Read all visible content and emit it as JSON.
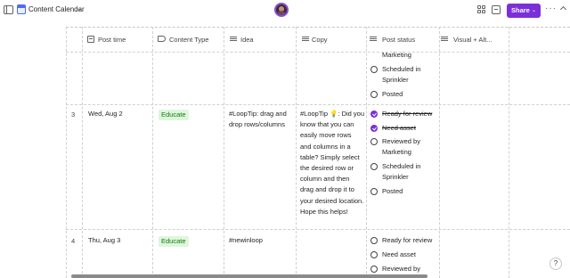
{
  "app": {
    "title": "Content Calendar",
    "share_label": "Share",
    "more_label": "···",
    "help_label": "?"
  },
  "icons": {
    "sidebar_toggle": "sidebar-icon",
    "page": "calendar-icon",
    "avatar": "user-avatar",
    "apps": "apps-icon",
    "comments": "comment-icon",
    "collapse": "collapse-icon"
  },
  "colors": {
    "accent": "#7b2fd9",
    "badge_bg": "#dff6dd",
    "badge_fg": "#107c10"
  },
  "table": {
    "columns": [
      {
        "label": "Post time",
        "icon": "grid-icon"
      },
      {
        "label": "Content Type",
        "icon": "tag-icon"
      },
      {
        "label": "Idea",
        "icon": "text-icon"
      },
      {
        "label": "Copy",
        "icon": "text-icon"
      },
      {
        "label": "Post status",
        "icon": "text-icon"
      },
      {
        "label": "Visual + Alt...",
        "icon": "text-icon"
      }
    ],
    "partial_row": {
      "status_options": [
        {
          "label": "Marketing",
          "checked": false,
          "show_circle": false
        },
        {
          "label": "Scheduled in Sprinkler",
          "checked": false,
          "show_circle": true
        },
        {
          "label": "Posted",
          "checked": false,
          "show_circle": true
        }
      ]
    },
    "rows": [
      {
        "number": "3",
        "post_time": "Wed, Aug 2",
        "content_type": "Educate",
        "idea": "#LoopTip: drag and drop rows/columns",
        "copy": "#LoopTip 💡: Did you know that you can easily move rows and columns in a table? Simply select the desired row or column and then drag and drop it to your desired location. Hope this helps!",
        "status_options": [
          {
            "label": "Ready for review",
            "checked": true
          },
          {
            "label": "Need asset",
            "checked": true
          },
          {
            "label": "Reviewed by Marketing",
            "checked": false
          },
          {
            "label": "Scheduled in Sprinkler",
            "checked": false
          },
          {
            "label": "Posted",
            "checked": false
          }
        ]
      },
      {
        "number": "4",
        "post_time": "Thu, Aug 3",
        "content_type": "Educate",
        "idea": "#newinloop",
        "copy": "",
        "status_options": [
          {
            "label": "Ready for review",
            "checked": false
          },
          {
            "label": "Need asset",
            "checked": false
          },
          {
            "label": "Reviewed by",
            "checked": false
          }
        ]
      }
    ]
  }
}
